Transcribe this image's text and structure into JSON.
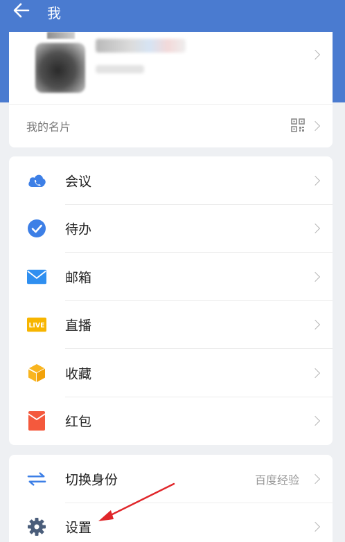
{
  "header": {
    "title": "我",
    "back_icon": "arrow-left-icon",
    "background": "#4a7bd0"
  },
  "profile": {
    "my_card_label": "我的名片",
    "qr_icon": "qr-code-icon"
  },
  "menu": {
    "items": [
      {
        "label": "会议",
        "icon": "meeting-cloud-icon",
        "color": "#3d7fe6"
      },
      {
        "label": "待办",
        "icon": "todo-check-icon",
        "color": "#3d7fe6"
      },
      {
        "label": "邮箱",
        "icon": "mail-icon",
        "color": "#2f8ff0"
      },
      {
        "label": "直播",
        "icon": "live-icon",
        "color": "#f7b500"
      },
      {
        "label": "收藏",
        "icon": "favorite-box-icon",
        "color": "#f9b51f"
      },
      {
        "label": "红包",
        "icon": "red-envelope-icon",
        "color": "#f4593d"
      }
    ]
  },
  "settings": {
    "items": [
      {
        "label": "切换身份",
        "value": "百度经验",
        "icon": "switch-arrows-icon",
        "color": "#3d7fe6"
      },
      {
        "label": "设置",
        "icon": "gear-icon",
        "color": "#4a5d7a"
      }
    ],
    "annotation_arrow_color": "#e0262a"
  },
  "live_badge": "LIVE"
}
